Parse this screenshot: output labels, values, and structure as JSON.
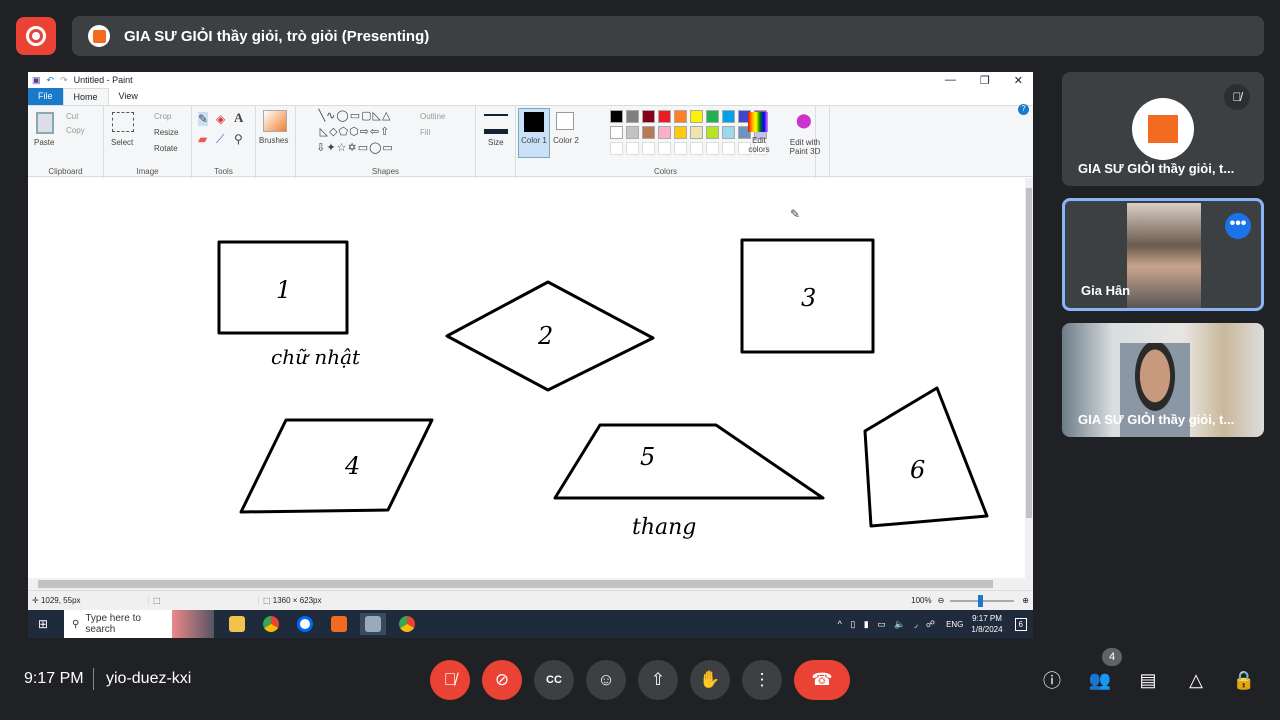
{
  "meet": {
    "presentation_title": "GIA SƯ GIỎI thầy giỏi, trò giỏi (Presenting)",
    "time": "9:17 PM",
    "meeting_code": "yio-duez-kxi",
    "participants_count": "4"
  },
  "paint": {
    "window_title": "Untitled - Paint",
    "tabs": [
      "File",
      "Home",
      "View"
    ],
    "clipboard": {
      "paste": "Paste",
      "cut": "Cut",
      "copy": "Copy",
      "label": "Clipboard"
    },
    "image": {
      "select": "Select",
      "crop": "Crop",
      "resize": "Resize",
      "rotate": "Rotate",
      "label": "Image"
    },
    "tools": {
      "label": "Tools"
    },
    "brushes": "Brushes",
    "shapes": {
      "outline": "Outline",
      "fill": "Fill",
      "label": "Shapes"
    },
    "size": "Size",
    "color1": "Color 1",
    "color2": "Color 2",
    "colors_label": "Colors",
    "edit_colors": "Edit colors",
    "edit_paint3d": "Edit with Paint 3D",
    "palette": [
      "#000000",
      "#7f7f7f",
      "#880015",
      "#ed1c24",
      "#ff7f27",
      "#fff200",
      "#22b14c",
      "#00a2e8",
      "#3f48cc",
      "#a349a4",
      "#ffffff",
      "#c3c3c3",
      "#b97a57",
      "#ffaec9",
      "#ffc90e",
      "#efe4b0",
      "#b5e61d",
      "#99d9ea",
      "#7092be",
      "#c8bfe7"
    ],
    "status": {
      "cursor": "1029, 55px",
      "canvas_size": "1360 × 623px",
      "zoom": "100%"
    },
    "drawing": {
      "labels": [
        "1",
        "2",
        "3",
        "4",
        "5",
        "6"
      ],
      "note1": "chữ nhật",
      "note2": "thang"
    }
  },
  "taskbar": {
    "search_placeholder": "Type here to search",
    "lang": "ENG",
    "time": "9:17 PM",
    "date": "1/8/2024",
    "notifications": "6"
  },
  "participants": [
    {
      "name": "GIA SƯ GIỎI thầy giỏi, t...",
      "muted": true
    },
    {
      "name": "Gia Hân",
      "active": true
    },
    {
      "name": "GIA SƯ GIỎI thầy giỏi, t..."
    }
  ],
  "colors": {
    "accent": "#8ab4f8",
    "danger": "#ea4335",
    "bg": "#202124"
  }
}
